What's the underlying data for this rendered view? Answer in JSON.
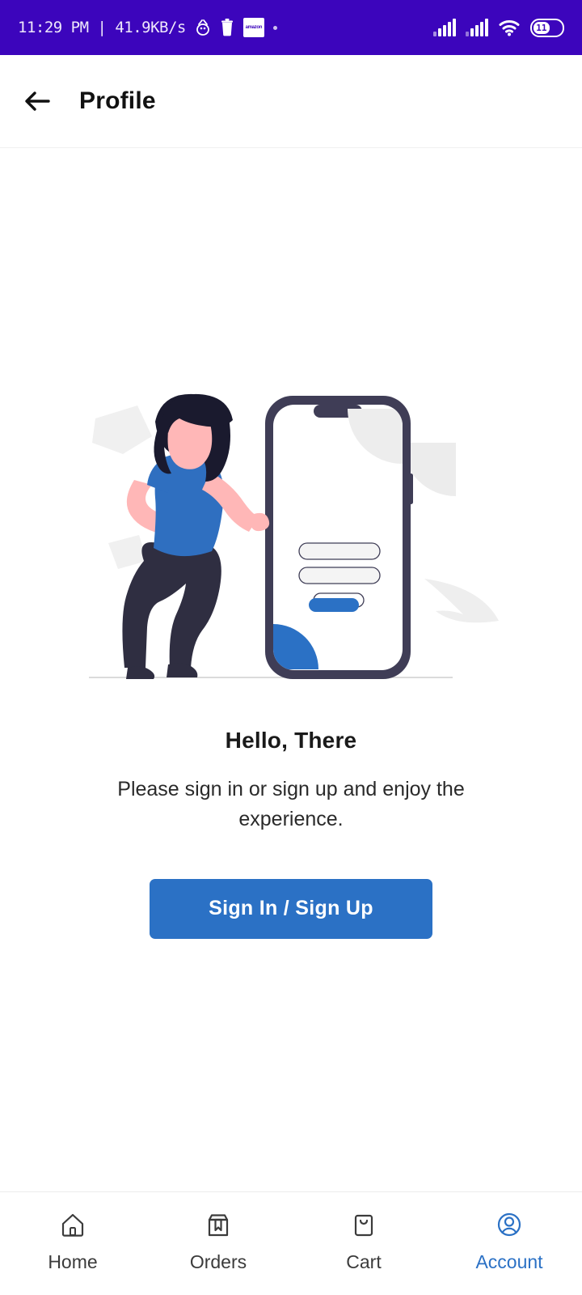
{
  "statusbar": {
    "clock": "11:29 PM | 41.9KB/s",
    "battery_level": "11",
    "icons": [
      "usb-debug-icon",
      "trash-icon",
      "app-badge-icon",
      "dot-icon",
      "signal-bars-icon",
      "signal-bars-2-icon",
      "wifi-icon",
      "battery-icon"
    ],
    "app_badge_text": "amazon",
    "background": "#3C05BC"
  },
  "appbar": {
    "back_icon": "arrow-left-icon",
    "title": "Profile"
  },
  "main": {
    "illustration_name": "mobile-login-illustration",
    "heading": "Hello, There",
    "subtitle": "Please sign in or sign up and enjoy the experience.",
    "cta_label": "Sign In / Sign Up",
    "accent_color": "#2B71C5"
  },
  "bottomnav": {
    "items": [
      {
        "label": "Home",
        "icon": "home-icon",
        "active": false
      },
      {
        "label": "Orders",
        "icon": "package-icon",
        "active": false
      },
      {
        "label": "Cart",
        "icon": "bag-icon",
        "active": false
      },
      {
        "label": "Account",
        "icon": "user-circle-icon",
        "active": true
      }
    ],
    "active_color": "#2B71C5"
  }
}
